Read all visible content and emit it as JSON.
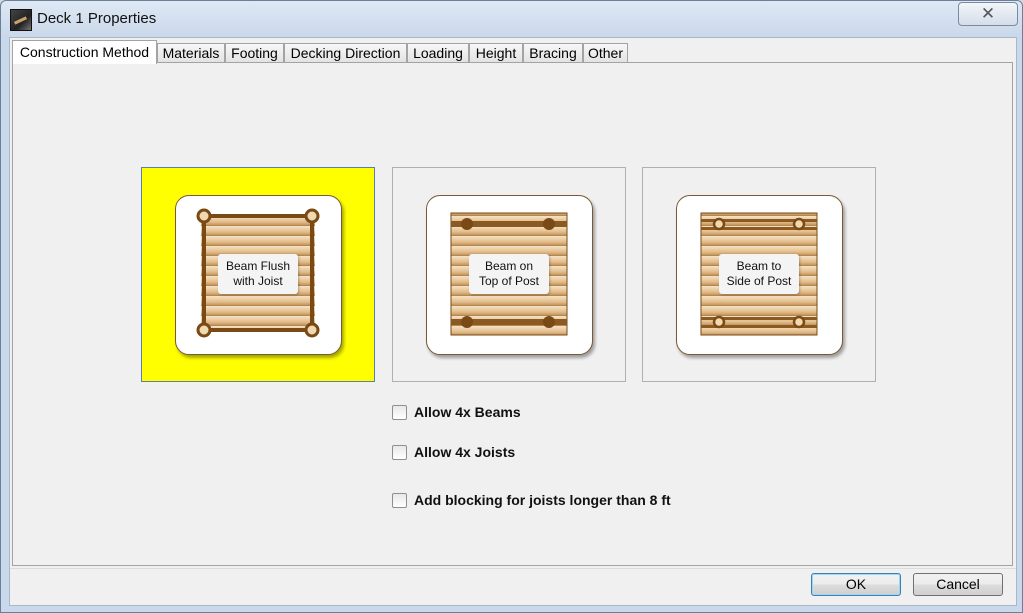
{
  "window": {
    "title": "Deck 1 Properties",
    "close_glyph": "✕"
  },
  "tabs": [
    {
      "label": "Construction Method",
      "active": true
    },
    {
      "label": "Materials"
    },
    {
      "label": "Footing"
    },
    {
      "label": "Decking Direction"
    },
    {
      "label": "Loading"
    },
    {
      "label": "Height"
    },
    {
      "label": "Bracing"
    },
    {
      "label": "Other"
    }
  ],
  "construction": {
    "selected_index": 0,
    "selected_color": "#ffff00",
    "options": [
      {
        "label": "Beam Flush\nwith Joist",
        "icon": "beam-flush-icon"
      },
      {
        "label": "Beam on\nTop of Post",
        "icon": "beam-top-post-icon"
      },
      {
        "label": "Beam to\nSide of Post",
        "icon": "beam-side-post-icon"
      }
    ]
  },
  "checkboxes": [
    {
      "label": "Allow 4x Beams",
      "checked": false
    },
    {
      "label": "Allow 4x Joists",
      "checked": false
    },
    {
      "label": "Add blocking for joists longer than 8 ft",
      "checked": false
    }
  ],
  "buttons": {
    "ok": "OK",
    "cancel": "Cancel"
  },
  "colors": {
    "wood_dark": "#7a4a16",
    "wood_light": "#e7c79a"
  }
}
